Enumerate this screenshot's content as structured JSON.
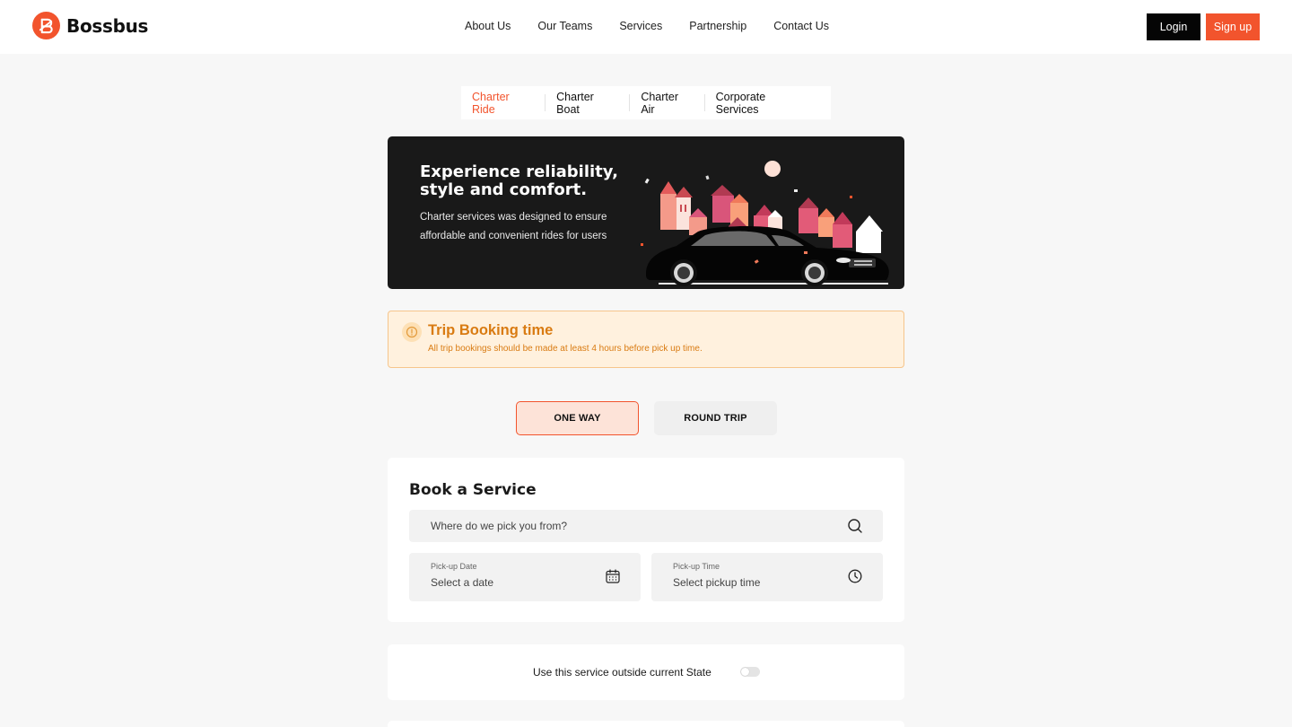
{
  "brand": {
    "name": "Bossbus",
    "color": "#f2542d"
  },
  "nav": {
    "items": [
      {
        "label": "About Us"
      },
      {
        "label": "Our Teams"
      },
      {
        "label": "Services"
      },
      {
        "label": "Partnership"
      },
      {
        "label": "Contact Us"
      }
    ]
  },
  "auth": {
    "login_label": "Login",
    "signup_label": "Sign up"
  },
  "service_tabs": {
    "active": "Charter Ride",
    "items": [
      {
        "label": "Charter Ride"
      },
      {
        "label": "Charter Boat"
      },
      {
        "label": "Charter Air"
      },
      {
        "label": "Corporate Services"
      }
    ]
  },
  "hero": {
    "title": "Experience reliability, style and comfort.",
    "subtitle": "Charter services was designed to ensure affordable and convenient rides for users"
  },
  "notice": {
    "icon": "info-icon",
    "title": "Trip Booking time",
    "text": "All trip bookings should be made at least 4 hours before pick up time."
  },
  "trip_type": {
    "selected": "ONE WAY",
    "one_way_label": "ONE WAY",
    "round_trip_label": "ROUND TRIP"
  },
  "booking": {
    "title": "Book a Service",
    "pickup_placeholder": "Where do we pick you from?",
    "pickup_date_label": "Pick-up Date",
    "pickup_date_value": "Select a date",
    "pickup_time_label": "Pick-up Time",
    "pickup_time_value": "Select pickup time"
  },
  "outside_state": {
    "label": "Use this service outside current State",
    "enabled": false
  }
}
